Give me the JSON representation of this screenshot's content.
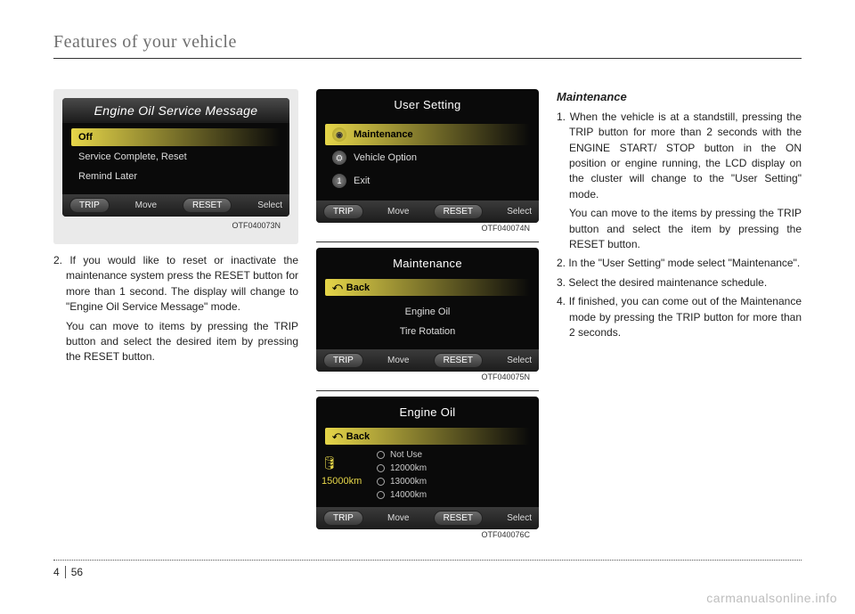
{
  "header": {
    "title": "Features of your vehicle"
  },
  "footer": {
    "chapter": "4",
    "page": "56",
    "watermark": "carmanualsonline.info"
  },
  "left": {
    "screen": {
      "title": "Engine Oil Service Message",
      "items": [
        {
          "label": "Off",
          "highlight": true
        },
        {
          "label": "Service Complete, Reset",
          "highlight": false
        },
        {
          "label": "Remind Later",
          "highlight": false
        }
      ],
      "foot": {
        "trip": "TRIP",
        "move": "Move",
        "reset": "RESET",
        "select": "Select"
      },
      "caption": "OTF040073N"
    },
    "para1": "2. If you would like to reset or inactivate the maintenance system press the RESET button for more than 1 second. The display will change to \"Engine Oil Service Message\" mode.",
    "para2": "You can move to items by pressing the TRIP button and select the desired item by pressing the RESET button."
  },
  "mid": {
    "screen1": {
      "title": "User Setting",
      "items": [
        {
          "label": "Maintenance",
          "iconClass": "hl",
          "highlight": true
        },
        {
          "label": "Vehicle Option",
          "iconClass": "",
          "highlight": false
        },
        {
          "label": "Exit",
          "iconClass": "",
          "highlight": false,
          "iconText": "1"
        }
      ],
      "foot": {
        "trip": "TRIP",
        "move": "Move",
        "reset": "RESET",
        "select": "Select"
      },
      "caption": "OTF040074N"
    },
    "screen2": {
      "title": "Maintenance",
      "back": "Back",
      "items": [
        {
          "label": "Engine Oil"
        },
        {
          "label": "Tire Rotation"
        }
      ],
      "foot": {
        "trip": "TRIP",
        "move": "Move",
        "reset": "RESET",
        "select": "Select"
      },
      "caption": "OTF040075N"
    },
    "screen3": {
      "title": "Engine Oil",
      "back": "Back",
      "side": "15000km",
      "options": [
        {
          "label": "Not Use"
        },
        {
          "label": "12000km"
        },
        {
          "label": "13000km"
        },
        {
          "label": "14000km"
        }
      ],
      "foot": {
        "trip": "TRIP",
        "move": "Move",
        "reset": "RESET",
        "select": "Select"
      },
      "caption": "OTF040076C"
    }
  },
  "right": {
    "heading": "Maintenance",
    "p1": "1. When the vehicle is at a standstill, pressing the TRIP button for more than 2 seconds with the ENGINE START/ STOP button in the ON position or engine running, the LCD display on the cluster will change to the \"User Setting\" mode.",
    "p1b": "You can move to the items by pressing the TRIP button and select the item by pressing the RESET button.",
    "p2": "2. In the \"User Setting\" mode select \"Maintenance\".",
    "p3": "3. Select the desired maintenance schedule.",
    "p4": "4. If finished, you can come out of the Maintenance mode by pressing the TRIP button for more than 2 seconds."
  }
}
